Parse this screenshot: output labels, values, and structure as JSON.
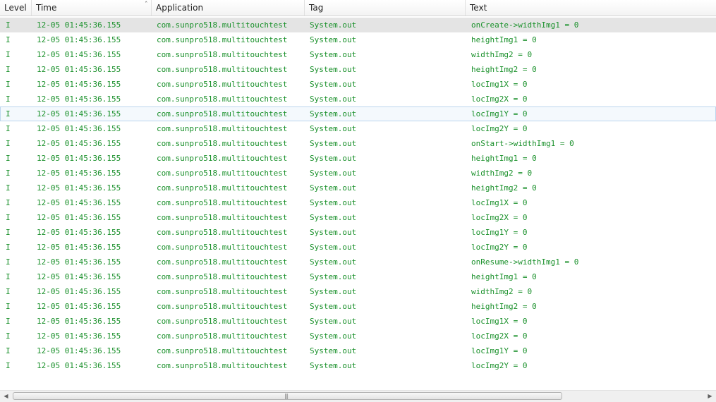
{
  "columns": [
    {
      "key": "level",
      "label": "Level"
    },
    {
      "key": "time",
      "label": "Time"
    },
    {
      "key": "application",
      "label": "Application"
    },
    {
      "key": "tag",
      "label": "Tag"
    },
    {
      "key": "text",
      "label": "Text"
    }
  ],
  "sort_indicator": "ˆ",
  "colors": {
    "log_text": "#19902a",
    "selected_row": "#e4e4e4",
    "hover_row_border": "#bcd6ee"
  },
  "rows": [
    {
      "level": "I",
      "time": "12-05 01:45:36.155",
      "application": "com.sunpro518.multitouchtest",
      "tag": "System.out",
      "text": "onCreate->widthImg1 = 0"
    },
    {
      "level": "I",
      "time": "12-05 01:45:36.155",
      "application": "com.sunpro518.multitouchtest",
      "tag": "System.out",
      "text": "heightImg1 = 0"
    },
    {
      "level": "I",
      "time": "12-05 01:45:36.155",
      "application": "com.sunpro518.multitouchtest",
      "tag": "System.out",
      "text": "widthImg2 = 0"
    },
    {
      "level": "I",
      "time": "12-05 01:45:36.155",
      "application": "com.sunpro518.multitouchtest",
      "tag": "System.out",
      "text": "heightImg2 = 0"
    },
    {
      "level": "I",
      "time": "12-05 01:45:36.155",
      "application": "com.sunpro518.multitouchtest",
      "tag": "System.out",
      "text": "locImg1X = 0"
    },
    {
      "level": "I",
      "time": "12-05 01:45:36.155",
      "application": "com.sunpro518.multitouchtest",
      "tag": "System.out",
      "text": "locImg2X = 0"
    },
    {
      "level": "I",
      "time": "12-05 01:45:36.155",
      "application": "com.sunpro518.multitouchtest",
      "tag": "System.out",
      "text": "locImg1Y = 0"
    },
    {
      "level": "I",
      "time": "12-05 01:45:36.155",
      "application": "com.sunpro518.multitouchtest",
      "tag": "System.out",
      "text": "locImg2Y = 0"
    },
    {
      "level": "I",
      "time": "12-05 01:45:36.155",
      "application": "com.sunpro518.multitouchtest",
      "tag": "System.out",
      "text": "onStart->widthImg1 = 0"
    },
    {
      "level": "I",
      "time": "12-05 01:45:36.155",
      "application": "com.sunpro518.multitouchtest",
      "tag": "System.out",
      "text": "heightImg1 = 0"
    },
    {
      "level": "I",
      "time": "12-05 01:45:36.155",
      "application": "com.sunpro518.multitouchtest",
      "tag": "System.out",
      "text": "widthImg2 = 0"
    },
    {
      "level": "I",
      "time": "12-05 01:45:36.155",
      "application": "com.sunpro518.multitouchtest",
      "tag": "System.out",
      "text": "heightImg2 = 0"
    },
    {
      "level": "I",
      "time": "12-05 01:45:36.155",
      "application": "com.sunpro518.multitouchtest",
      "tag": "System.out",
      "text": "locImg1X = 0"
    },
    {
      "level": "I",
      "time": "12-05 01:45:36.155",
      "application": "com.sunpro518.multitouchtest",
      "tag": "System.out",
      "text": "locImg2X = 0"
    },
    {
      "level": "I",
      "time": "12-05 01:45:36.155",
      "application": "com.sunpro518.multitouchtest",
      "tag": "System.out",
      "text": "locImg1Y = 0"
    },
    {
      "level": "I",
      "time": "12-05 01:45:36.155",
      "application": "com.sunpro518.multitouchtest",
      "tag": "System.out",
      "text": "locImg2Y = 0"
    },
    {
      "level": "I",
      "time": "12-05 01:45:36.155",
      "application": "com.sunpro518.multitouchtest",
      "tag": "System.out",
      "text": "onResume->widthImg1 = 0"
    },
    {
      "level": "I",
      "time": "12-05 01:45:36.155",
      "application": "com.sunpro518.multitouchtest",
      "tag": "System.out",
      "text": "heightImg1 = 0"
    },
    {
      "level": "I",
      "time": "12-05 01:45:36.155",
      "application": "com.sunpro518.multitouchtest",
      "tag": "System.out",
      "text": "widthImg2 = 0"
    },
    {
      "level": "I",
      "time": "12-05 01:45:36.155",
      "application": "com.sunpro518.multitouchtest",
      "tag": "System.out",
      "text": "heightImg2 = 0"
    },
    {
      "level": "I",
      "time": "12-05 01:45:36.155",
      "application": "com.sunpro518.multitouchtest",
      "tag": "System.out",
      "text": "locImg1X = 0"
    },
    {
      "level": "I",
      "time": "12-05 01:45:36.155",
      "application": "com.sunpro518.multitouchtest",
      "tag": "System.out",
      "text": "locImg2X = 0"
    },
    {
      "level": "I",
      "time": "12-05 01:45:36.155",
      "application": "com.sunpro518.multitouchtest",
      "tag": "System.out",
      "text": "locImg1Y = 0"
    },
    {
      "level": "I",
      "time": "12-05 01:45:36.155",
      "application": "com.sunpro518.multitouchtest",
      "tag": "System.out",
      "text": "locImg2Y = 0"
    }
  ],
  "selected_row_index": 0,
  "hovered_row_index": 6,
  "scrollbar": {
    "left_arrow_icon": "◀",
    "right_arrow_icon": "▶",
    "grip_glyph": "|||"
  }
}
